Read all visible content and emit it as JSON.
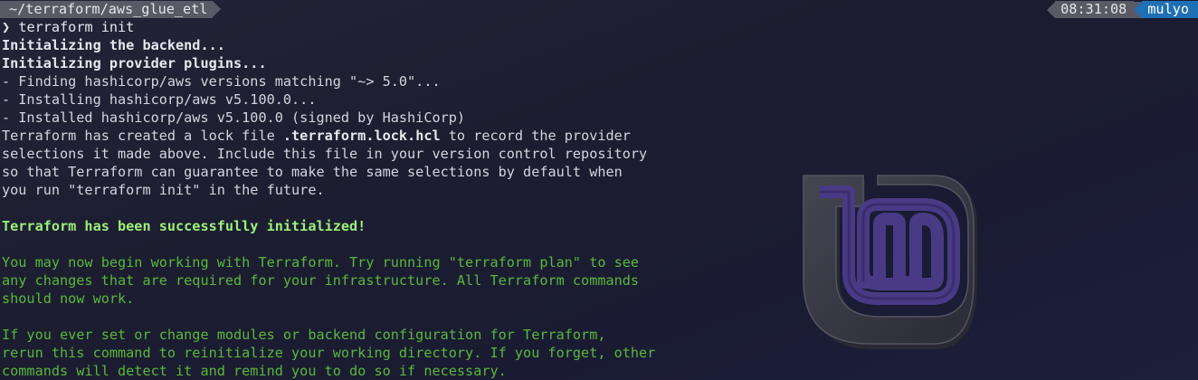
{
  "prompt": {
    "path": "~/terraform/aws_glue_etl",
    "time": "08:31:08",
    "user": "mulyo",
    "symbol": "❯",
    "command": "terraform init"
  },
  "output": {
    "init_backend": "Initializing the backend...",
    "init_plugins": "Initializing provider plugins...",
    "finding": "- Finding hashicorp/aws versions matching \"~> 5.0\"...",
    "installing": "- Installing hashicorp/aws v5.100.0...",
    "installed": "- Installed hashicorp/aws v5.100.0 (signed by HashiCorp)",
    "lock_pre": "Terraform has created a lock file ",
    "lock_file": ".terraform.lock.hcl",
    "lock_post": " to record the provider",
    "lock_line2": "selections it made above. Include this file in your version control repository",
    "lock_line3": "so that Terraform can guarantee to make the same selections by default when",
    "lock_line4": "you run \"terraform init\" in the future.",
    "success": "Terraform has been successfully initialized!",
    "begin_line1": "You may now begin working with Terraform. Try running \"terraform plan\" to see",
    "begin_line2": "any changes that are required for your infrastructure. All Terraform commands",
    "begin_line3": "should now work.",
    "modules_line1": "If you ever set or change modules or backend configuration for Terraform,",
    "modules_line2": "rerun this command to reinitialize your working directory. If you forget, other",
    "modules_line3": "commands will detect it and remind you to do so if necessary."
  },
  "wallpaper": {
    "logo": "linux-mint-logo"
  },
  "colors": {
    "background": "#1c1d30",
    "text": "#d6d3de",
    "success_green": "#9bf07a",
    "info_green": "#58b83a",
    "segment_gray": "#5a5a66",
    "segment_blue": "#1f6fb5"
  }
}
